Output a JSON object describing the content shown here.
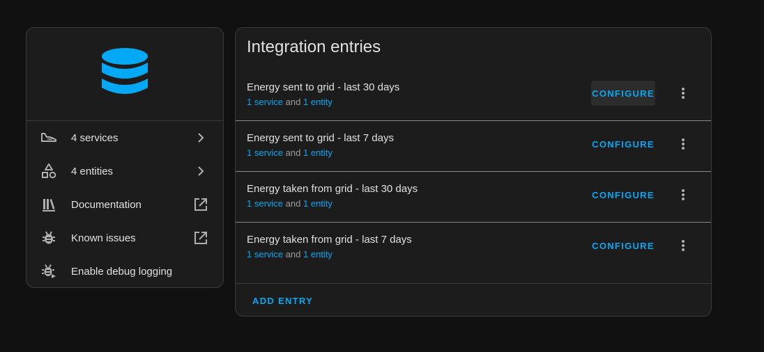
{
  "colors": {
    "background": "#111111",
    "card": "#1c1c1c",
    "accent": "#03a9f4",
    "text": "#e1e1e1",
    "secondary_text": "#9e9e9e",
    "icon": "#b0b0b0"
  },
  "info_card": {
    "logo_icon": "database-icon",
    "items": [
      {
        "label": "4 services",
        "icon": "services-icon",
        "trail_icon": "chevron-right-icon"
      },
      {
        "label": "4 entities",
        "icon": "shapes-icon",
        "trail_icon": "chevron-right-icon"
      },
      {
        "label": "Documentation",
        "icon": "bookshelf-icon",
        "trail_icon": "open-in-new-icon"
      },
      {
        "label": "Known issues",
        "icon": "bug-icon",
        "trail_icon": "open-in-new-icon"
      },
      {
        "label": "Enable debug logging",
        "icon": "bug-play-icon",
        "trail_icon": ""
      }
    ]
  },
  "entries_card": {
    "title": "Integration entries",
    "entries": [
      {
        "title": "Energy sent to grid - last 30 days",
        "service_link": "1 service",
        "connector": "and",
        "entity_link": "1 entity",
        "configure_label": "CONFIGURE"
      },
      {
        "title": "Energy sent to grid - last 7 days",
        "service_link": "1 service",
        "connector": "and",
        "entity_link": "1 entity",
        "configure_label": "CONFIGURE"
      },
      {
        "title": "Energy taken from grid - last 30 days",
        "service_link": "1 service",
        "connector": "and",
        "entity_link": "1 entity",
        "configure_label": "CONFIGURE"
      },
      {
        "title": "Energy taken from grid - last 7 days",
        "service_link": "1 service",
        "connector": "and",
        "entity_link": "1 entity",
        "configure_label": "CONFIGURE"
      }
    ],
    "add_entry_label": "ADD ENTRY"
  }
}
